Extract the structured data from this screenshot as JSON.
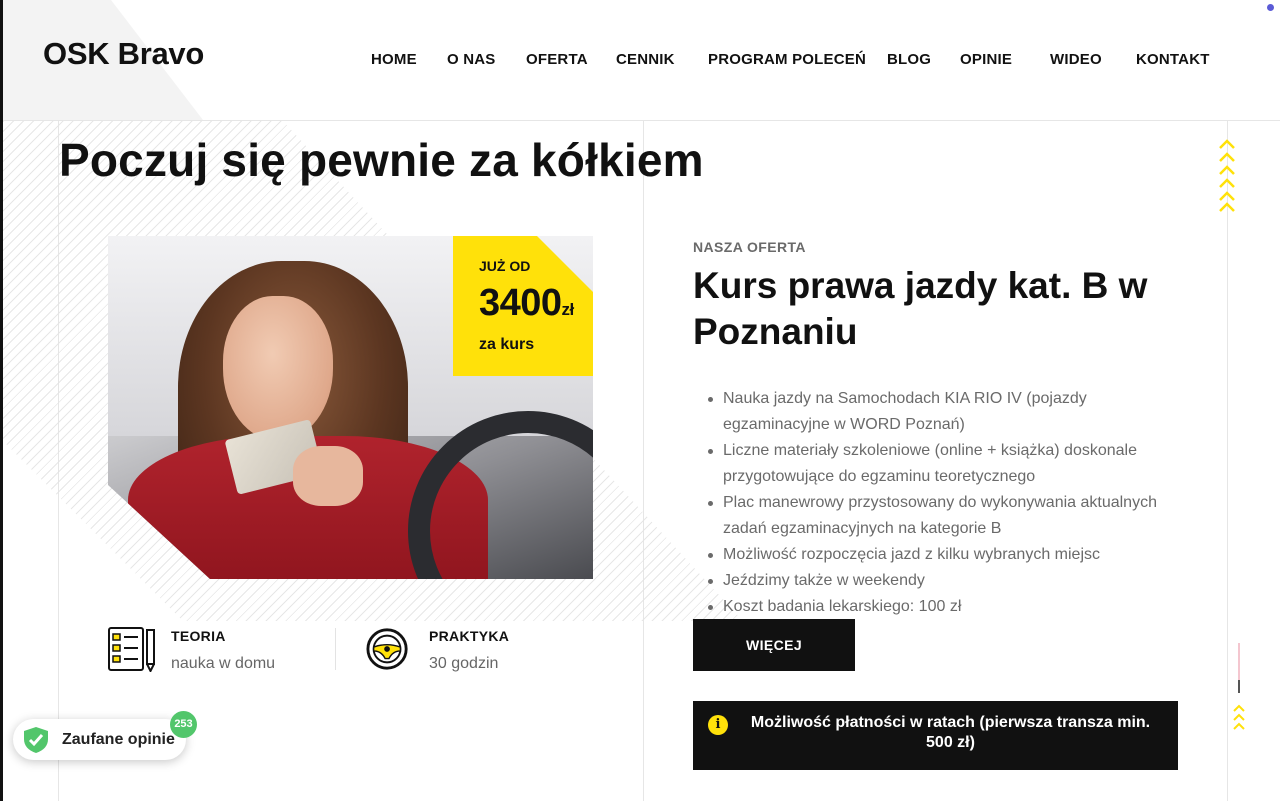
{
  "brand": {
    "logo_bold": "OSK",
    "logo_rest": "Bravo"
  },
  "nav": {
    "items": [
      {
        "label": "HOME"
      },
      {
        "label": "O NAS"
      },
      {
        "label": "OFERTA"
      },
      {
        "label": "CENNIK"
      },
      {
        "label": "PROGRAM POLECEŃ"
      },
      {
        "label": "BLOG"
      },
      {
        "label": "OPINIE"
      },
      {
        "label": "WIDEO"
      },
      {
        "label": "KONTAKT"
      }
    ]
  },
  "hero": {
    "title": "Poczuj się pewnie za kółkiem"
  },
  "price": {
    "from": "JUŻ OD",
    "amount": "3400",
    "currency": "zł",
    "per": "za kurs"
  },
  "features": [
    {
      "icon": "checklist-icon",
      "label": "TEORIA",
      "value": "nauka w domu"
    },
    {
      "icon": "steering-wheel-icon",
      "label": "PRAKTYKA",
      "value": "30 godzin"
    }
  ],
  "offer": {
    "eyebrow": "NASZA OFERTA",
    "title": "Kurs prawa jazdy kat. B w Poznaniu",
    "bullets": [
      "Nauka jazdy na Samochodach KIA RIO IV (pojazdy egzaminacyjne w WORD Poznań)",
      "Liczne materiały szkoleniowe (online + książka) doskonale przygotowujące do egzaminu teoretycznego",
      "Plac manewrowy przystosowany do wykonywania aktualnych zadań egzaminacyjnych na kategorie B",
      "Możliwość rozpoczęcia jazd z kilku wybranych miejsc",
      "Jeździmy także w weekendy",
      "Koszt badania lekarskiego: 100 zł"
    ],
    "more_label": "WIĘCEJ",
    "notice": "Możliwość płatności w ratach (pierwsza transza min. 500 zł)"
  },
  "trust_badge": {
    "label": "Zaufane opinie",
    "count": "253"
  },
  "colors": {
    "accent_yellow": "#ffe10a",
    "dark": "#111111",
    "badge_green": "#52c66b",
    "muted_text": "#6a6a6a"
  }
}
